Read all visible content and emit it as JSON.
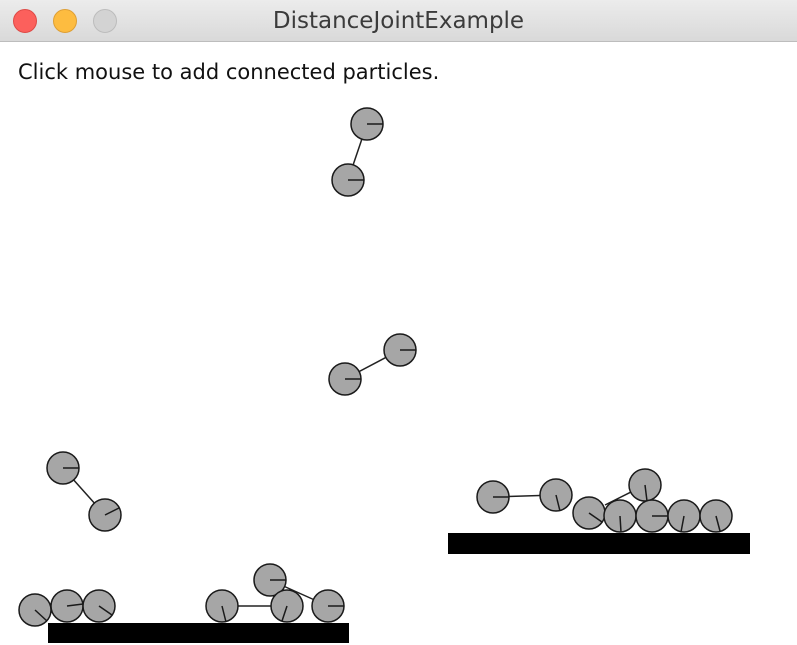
{
  "window": {
    "title": "DistanceJointExample",
    "controls": [
      "close-button",
      "minimize-button",
      "zoom-button"
    ]
  },
  "content": {
    "instructions": "Click mouse to add connected particles."
  },
  "colors": {
    "particle_fill": "#a6a6a6",
    "particle_stroke": "#1a1a1a",
    "platform": "#000000",
    "background": "#ffffff"
  }
}
